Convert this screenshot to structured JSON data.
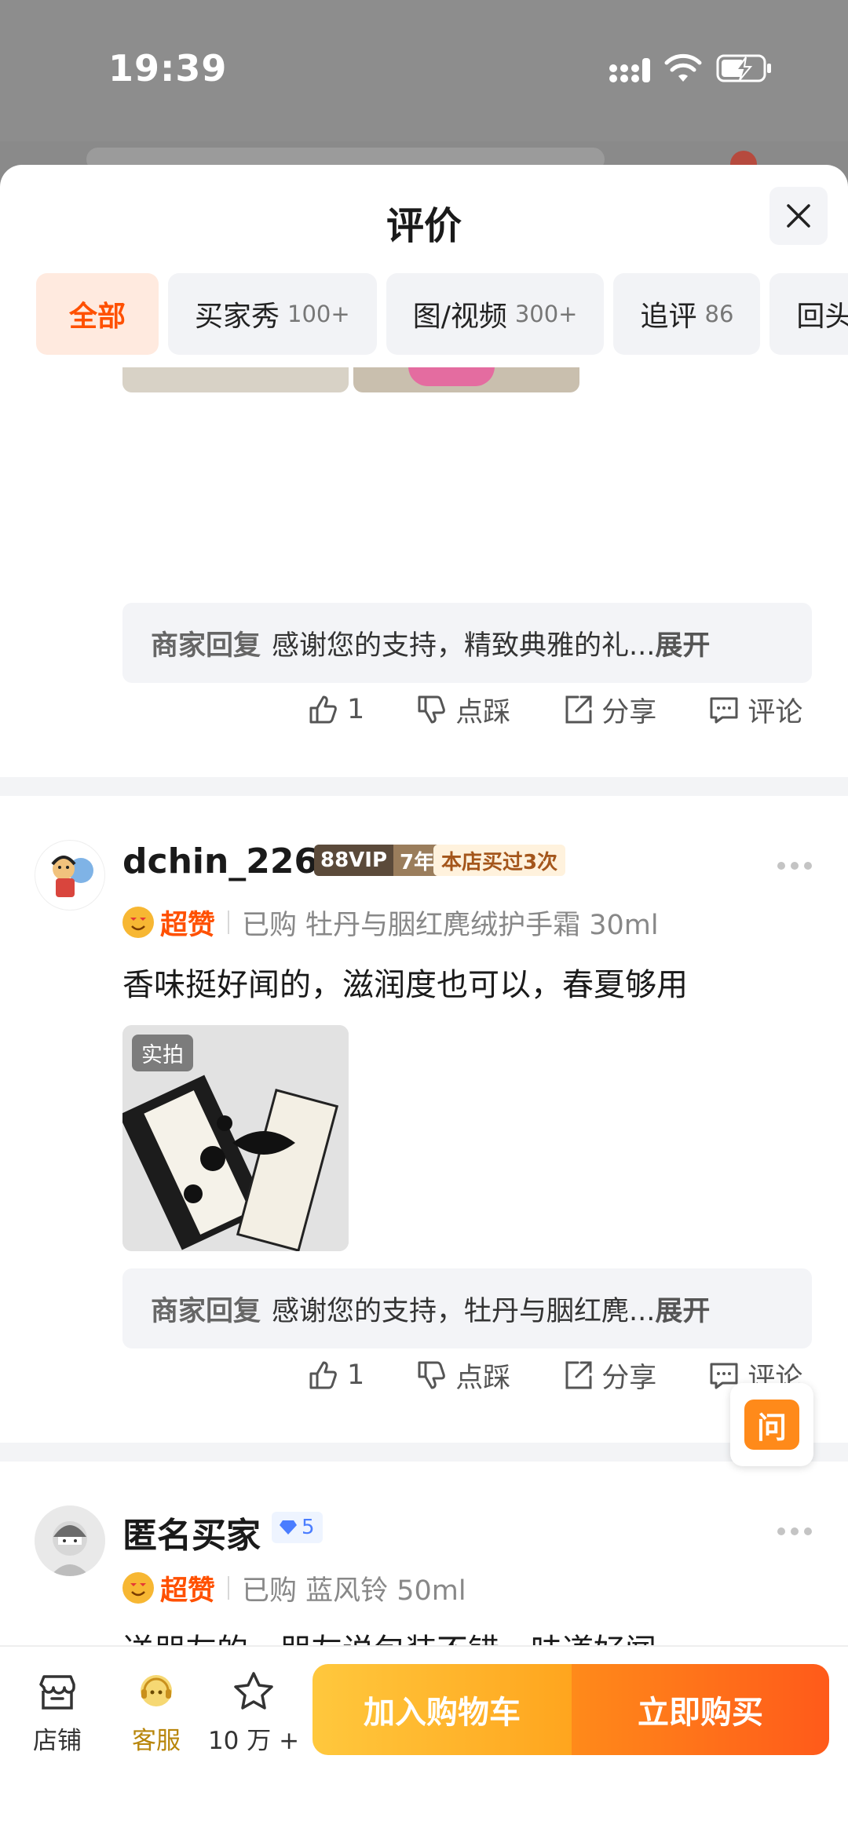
{
  "status": {
    "time": "19:39"
  },
  "sheet": {
    "title": "评价"
  },
  "tabs": [
    {
      "label": "全部",
      "count": ""
    },
    {
      "label": "买家秀",
      "count": "100+"
    },
    {
      "label": "图/视频",
      "count": "300+"
    },
    {
      "label": "追评",
      "count": "86"
    },
    {
      "label": "回头客",
      "count": ""
    }
  ],
  "review_top": {
    "reply_label": "商家回复",
    "reply_text": "感谢您的支持，精致典雅的礼...",
    "reply_more": "展开",
    "like_count": "1",
    "dislike_label": "点踩",
    "share_label": "分享",
    "comment_label": "评论"
  },
  "review1": {
    "username": "dchin_226",
    "vip_a": "88VIP",
    "vip_b": "7年",
    "bought_badge": "本店买过3次",
    "rating": "超赞",
    "purchased": "已购 牡丹与胭红麂绒护手霜 30ml",
    "text": "香味挺好闻的，滋润度也可以，春夏够用",
    "photo_tag": "实拍",
    "reply_label": "商家回复",
    "reply_text": "感谢您的支持，牡丹与胭红麂...",
    "reply_more": "展开",
    "like_count": "1",
    "dislike_label": "点踩",
    "share_label": "分享",
    "comment_label": "评论"
  },
  "review2": {
    "username": "匿名买家",
    "level": "5",
    "rating": "超赞",
    "purchased": "已购 蓝风铃 50ml",
    "text": "送朋友的，朋友说包装不错，味道好闻"
  },
  "ask_button": "问",
  "bottom_bar": {
    "store_label": "店铺",
    "service_label": "客服",
    "fav_label": "10 万 +",
    "cart_label": "加入购物车",
    "buy_label": "立即购买"
  },
  "colors": {
    "accent": "#ff5000",
    "cart": "#ffb52c",
    "buy": "#ff6a1a"
  }
}
